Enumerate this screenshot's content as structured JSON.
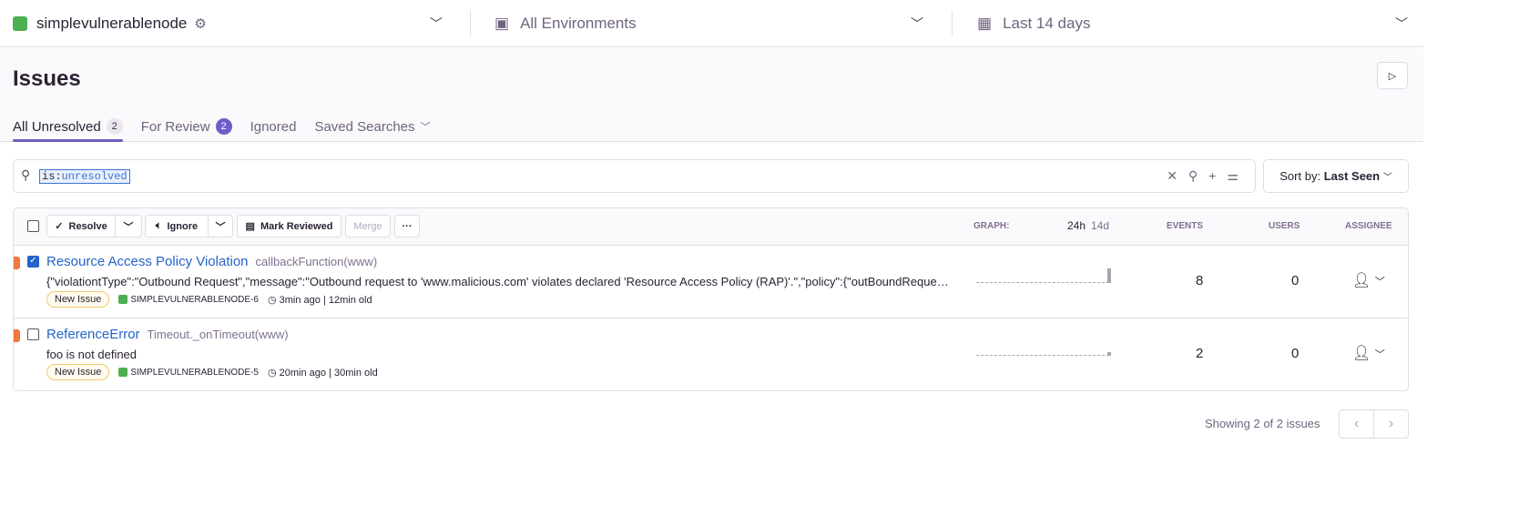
{
  "topbar": {
    "project": "simplevulnerablenode",
    "environment": "All Environments",
    "period": "Last 14 days"
  },
  "header": {
    "title": "Issues",
    "tabs": [
      {
        "label": "All Unresolved",
        "count": "2"
      },
      {
        "label": "For Review",
        "count": "2"
      },
      {
        "label": "Ignored"
      },
      {
        "label": "Saved Searches"
      }
    ]
  },
  "search": {
    "key": "is:",
    "value": "unresolved"
  },
  "sort": {
    "label": "Sort by:",
    "value": "Last Seen"
  },
  "actions": {
    "resolve": "Resolve",
    "ignore": "Ignore",
    "mark_reviewed": "Mark Reviewed",
    "merge": "Merge",
    "more": "···"
  },
  "columns": {
    "graph": "GRAPH:",
    "p24h": "24h",
    "p14d": "14d",
    "events": "EVENTS",
    "users": "USERS",
    "assignee": "ASSIGNEE"
  },
  "issues": [
    {
      "title": "Resource Access Policy Violation",
      "culprit": "callbackFunction(www)",
      "message": "{\"violationtType\":\"Outbound Request\",\"message\":\"Outbound request to 'www.malicious.com' violates declared 'Resource Access Policy (RAP)'.\",\"policy\":{\"outBoundRequests\"",
      "badge": "New Issue",
      "short_id": "SIMPLEVULNERABLENODE-6",
      "last_seen": "3min ago",
      "age": "12min old",
      "events": "8",
      "users": "0",
      "checked": true,
      "level_color": "#f2763f"
    },
    {
      "title": "ReferenceError",
      "culprit": "Timeout._onTimeout(www)",
      "message": "foo is not defined",
      "badge": "New Issue",
      "short_id": "SIMPLEVULNERABLENODE-5",
      "last_seen": "20min ago",
      "age": "30min old",
      "events": "2",
      "users": "0",
      "checked": false,
      "level_color": "#f2763f"
    }
  ],
  "footer": {
    "summary": "Showing 2 of 2 issues"
  }
}
